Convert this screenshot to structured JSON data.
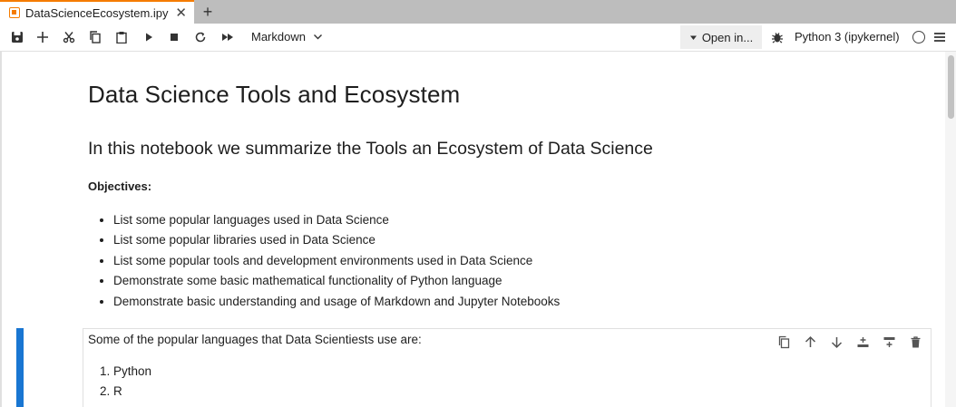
{
  "tab": {
    "title": "DataScienceEcosystem.ipy",
    "close": "✕",
    "new": "+"
  },
  "toolbar": {
    "icons": [
      "save-icon",
      "add-cell-icon",
      "cut-icon",
      "copy-icon",
      "paste-icon",
      "run-icon",
      "stop-icon",
      "restart-icon",
      "run-all-icon"
    ],
    "cell_type": "Markdown",
    "open_in": "Open in...",
    "kernel": "Python 3 (ipykernel)"
  },
  "notebook": {
    "title": "Data Science Tools and Ecosystem",
    "intro": "In this notebook we summarize the Tools an Ecosystem of Data Science",
    "objectives_label": "Objectives:",
    "objectives": [
      "List some popular languages used in Data Science",
      "List some popular libraries used in Data Science",
      "List some popular tools and development environments used in Data Science",
      "Demonstrate some basic mathematical functionality of Python language",
      "Demonstrate basic understanding and usage of Markdown and Jupyter Notebooks"
    ],
    "active_cell": {
      "text": "Some of the popular languages that Data Scientiests use are:",
      "languages": [
        "Python",
        "R"
      ]
    }
  },
  "colors": {
    "accent": "#1976d2",
    "tab_accent": "#f57c00",
    "tabbar": "#bdbdbd"
  }
}
